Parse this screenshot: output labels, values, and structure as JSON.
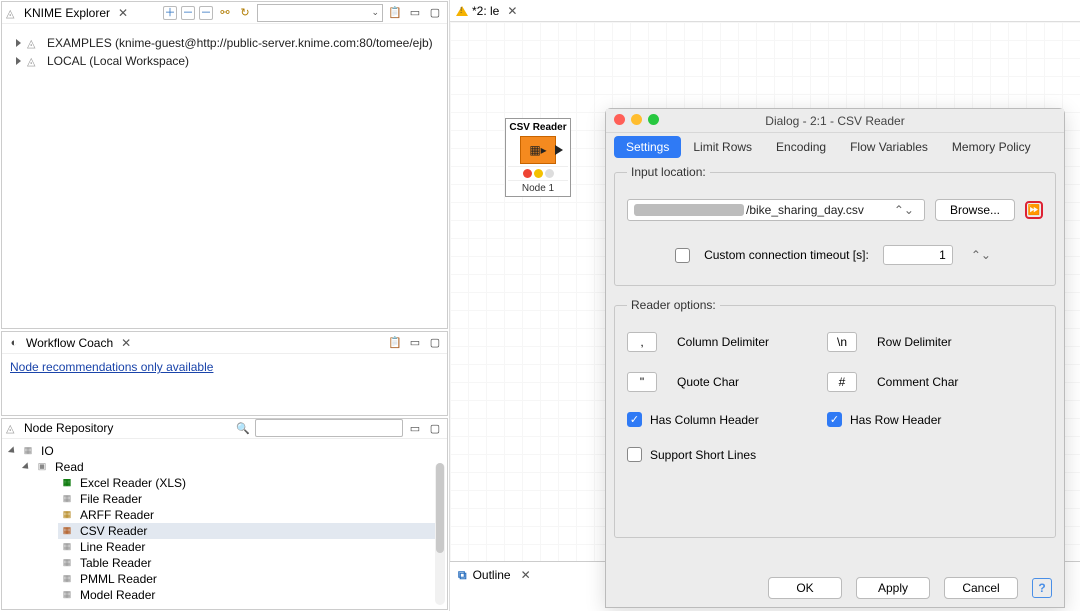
{
  "explorer": {
    "title": "KNIME Explorer",
    "items": [
      {
        "label": "EXAMPLES (knime-guest@http://public-server.knime.com:80/tomee/ejb)"
      },
      {
        "label": "LOCAL (Local Workspace)"
      }
    ]
  },
  "coach": {
    "title": "Workflow Coach",
    "link": "Node recommendations only available"
  },
  "repo": {
    "title": "Node Repository",
    "current_folder": "IO",
    "subfolder": "Read",
    "items": [
      "Excel Reader (XLS)",
      "File Reader",
      "ARFF Reader",
      "CSV Reader",
      "Line Reader",
      "Table Reader",
      "PMML Reader",
      "Model Reader"
    ],
    "selected_index": 3
  },
  "canvas": {
    "tab_label": "*2: le",
    "node_type": "CSV Reader",
    "node_label": "Node 1"
  },
  "outline": {
    "title": "Outline"
  },
  "dialog": {
    "window_title": "Dialog - 2:1 - CSV Reader",
    "tabs": [
      "Settings",
      "Limit Rows",
      "Encoding",
      "Flow Variables",
      "Memory Policy"
    ],
    "active_tab": 0,
    "input_location": {
      "legend": "Input location:",
      "path_suffix": "/bike_sharing_day.csv",
      "browse": "Browse...",
      "custom_timeout_label": "Custom connection timeout [s]:",
      "custom_timeout_checked": false,
      "custom_timeout_value": "1"
    },
    "reader_options": {
      "legend": "Reader options:",
      "col_delim_value": ",",
      "col_delim_label": "Column Delimiter",
      "row_delim_value": "\\n",
      "row_delim_label": "Row Delimiter",
      "quote_value": "\"",
      "quote_label": "Quote Char",
      "comment_value": "#",
      "comment_label": "Comment Char",
      "has_col_header_label": "Has Column Header",
      "has_col_header": true,
      "has_row_header_label": "Has Row Header",
      "has_row_header": true,
      "short_lines_label": "Support Short Lines",
      "short_lines": false
    },
    "buttons": {
      "ok": "OK",
      "apply": "Apply",
      "cancel": "Cancel"
    }
  }
}
